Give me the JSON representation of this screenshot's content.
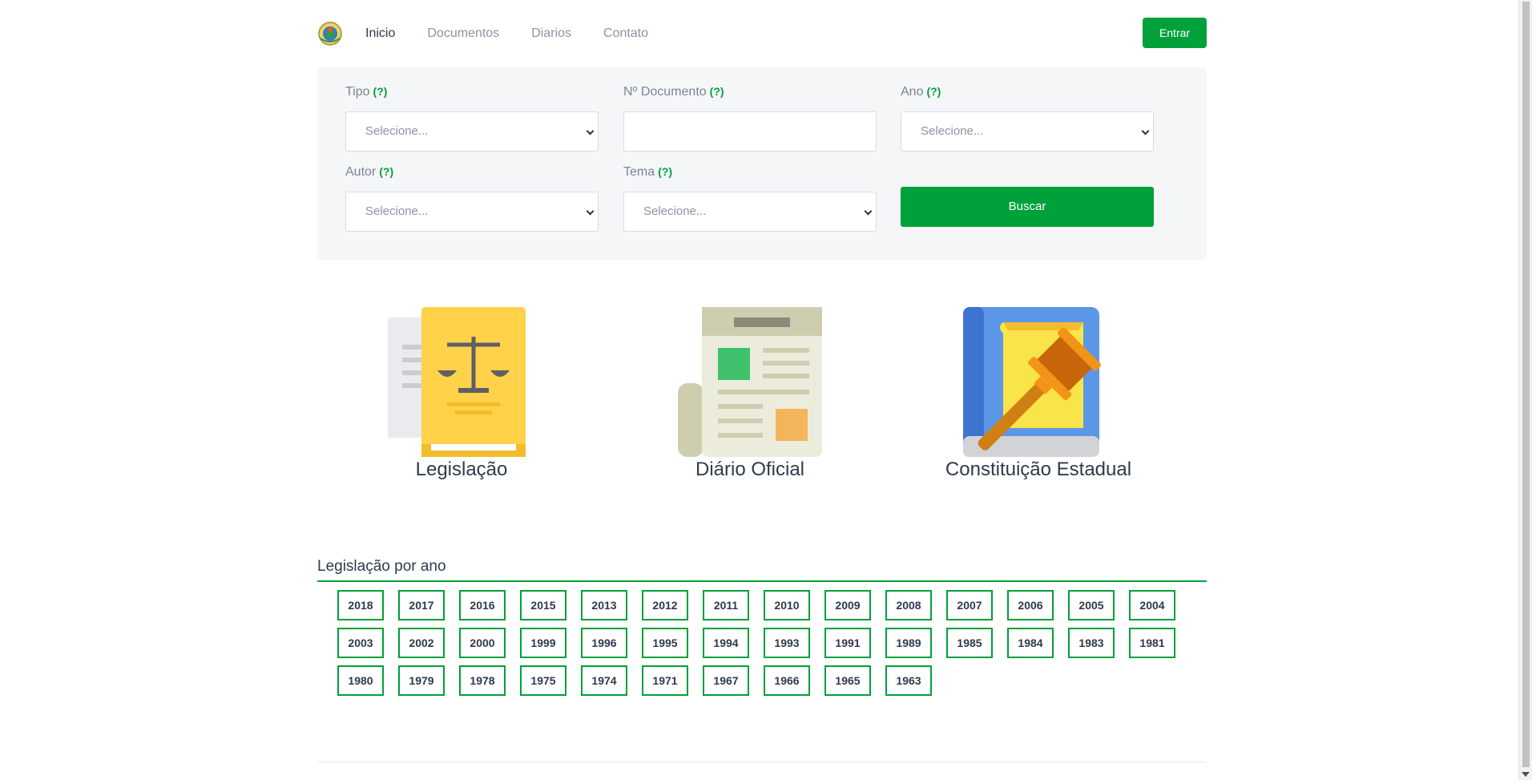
{
  "nav": {
    "logo": "state-coat-of-arms-logo",
    "links": [
      "Inicio",
      "Documentos",
      "Diarios",
      "Contato"
    ],
    "active_link": "Inicio",
    "login_label": "Entrar"
  },
  "search": {
    "help_label": "(?)",
    "tipo": {
      "label": "Tipo",
      "placeholder": "Selecione..."
    },
    "documento": {
      "label": "Nº Documento",
      "value": ""
    },
    "ano": {
      "label": "Ano",
      "placeholder": "Selecione..."
    },
    "autor": {
      "label": "Autor",
      "placeholder": "Selecione..."
    },
    "tema": {
      "label": "Tema",
      "placeholder": "Selecione..."
    },
    "submit_label": "Buscar"
  },
  "cards": [
    {
      "title": "Legislação",
      "icon": "legislation-scales-icon"
    },
    {
      "title": "Diário Oficial",
      "icon": "newspaper-icon"
    },
    {
      "title": "Constituição Estadual",
      "icon": "gavel-book-icon"
    }
  ],
  "years_section": {
    "title": "Legislação por ano",
    "years": [
      "2018",
      "2017",
      "2016",
      "2015",
      "2013",
      "2012",
      "2011",
      "2010",
      "2009",
      "2008",
      "2007",
      "2006",
      "2005",
      "2004",
      "2003",
      "2002",
      "2000",
      "1999",
      "1996",
      "1995",
      "1994",
      "1993",
      "1991",
      "1989",
      "1985",
      "1984",
      "1983",
      "1981",
      "1980",
      "1979",
      "1978",
      "1975",
      "1974",
      "1971",
      "1967",
      "1966",
      "1965",
      "1963"
    ]
  },
  "colors": {
    "accent": "#00a03b",
    "panel_bg": "#f5f6f8",
    "text": "#2f3a4d"
  }
}
